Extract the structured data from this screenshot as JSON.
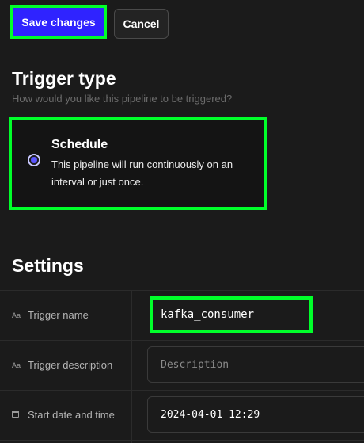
{
  "toolbar": {
    "save_label": "Save changes",
    "cancel_label": "Cancel"
  },
  "trigger_type": {
    "title": "Trigger type",
    "subtitle": "How would you like this pipeline to be triggered?",
    "option": {
      "title": "Schedule",
      "description": "This pipeline will run continuously on an interval or just once.",
      "selected": true
    }
  },
  "settings": {
    "title": "Settings",
    "rows": [
      {
        "label": "Trigger name",
        "icon": "Aa",
        "value": "kafka_consumer",
        "placeholder": ""
      },
      {
        "label": "Trigger description",
        "icon": "Aa",
        "value": "",
        "placeholder": "Description"
      },
      {
        "label": "Start date and time",
        "icon": "calendar-icon",
        "value": "2024-04-01 12:29",
        "placeholder": ""
      }
    ]
  },
  "colors": {
    "accent": "#2f23ff",
    "highlight": "#00ff2a",
    "background": "#1b1b1b"
  }
}
